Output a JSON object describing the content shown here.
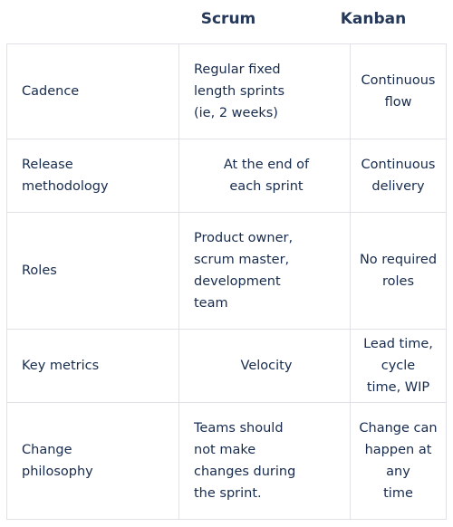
{
  "header": {
    "scrum": "Scrum",
    "kanban": "Kanban"
  },
  "rows": [
    {
      "label": "Cadence",
      "scrum_lines": [
        "Regular fixed",
        "length sprints",
        "(ie, 2 weeks)"
      ],
      "kanban_lines": [
        "Continuous flow"
      ]
    },
    {
      "label_lines": [
        "Release",
        "methodology"
      ],
      "scrum_lines": [
        "At the end of",
        "each sprint"
      ],
      "kanban_lines": [
        "Continuous",
        "delivery"
      ]
    },
    {
      "label": "Roles",
      "scrum_lines": [
        "Product owner,",
        "scrum master,",
        "development",
        "team"
      ],
      "kanban_lines": [
        "No required",
        "roles"
      ]
    },
    {
      "label": "Key metrics",
      "scrum_lines": [
        "Velocity"
      ],
      "kanban_lines": [
        "Lead time, cycle",
        "time, WIP"
      ]
    },
    {
      "label_lines": [
        "Change",
        "philosophy"
      ],
      "scrum_lines": [
        "Teams should",
        "not make",
        "changes during",
        "the sprint."
      ],
      "kanban_lines": [
        "Change can",
        "happen at any",
        "time"
      ]
    }
  ]
}
